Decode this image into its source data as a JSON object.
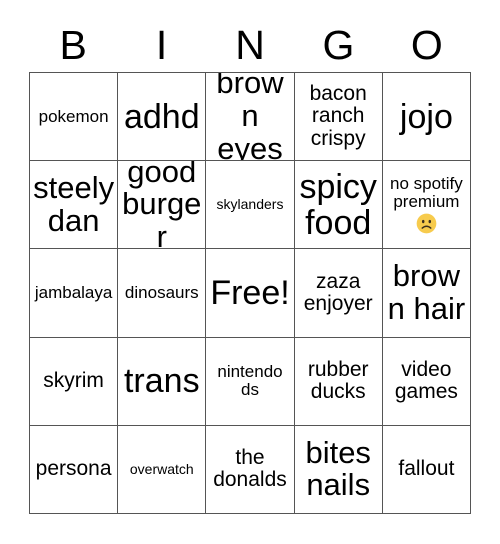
{
  "card": {
    "title": "BINGO",
    "header_letters": [
      "B",
      "I",
      "N",
      "G",
      "O"
    ],
    "rows": [
      [
        {
          "text": "pokemon",
          "size": "fs-sm"
        },
        {
          "text": "adhd",
          "size": "fs-xxl"
        },
        {
          "text": "brown eyes",
          "size": "fs-xl"
        },
        {
          "text": "bacon ranch crispy",
          "size": "fs-md"
        },
        {
          "text": "jojo",
          "size": "fs-xxl"
        }
      ],
      [
        {
          "text": "steely dan",
          "size": "fs-xl"
        },
        {
          "text": "good burger",
          "size": "fs-xl"
        },
        {
          "text": "skylanders",
          "size": "fs-xs"
        },
        {
          "text": "spicy food",
          "size": "fs-xxl"
        },
        {
          "text": "no spotify premium",
          "size": "fs-sm",
          "emoji": "frowning-face"
        }
      ],
      [
        {
          "text": "jambalaya",
          "size": "fs-sm"
        },
        {
          "text": "dinosaurs",
          "size": "fs-sm"
        },
        {
          "text": "Free!",
          "size": "fs-xxl",
          "free": true
        },
        {
          "text": "zaza enjoyer",
          "size": "fs-md"
        },
        {
          "text": "brown hair",
          "size": "fs-xl"
        }
      ],
      [
        {
          "text": "skyrim",
          "size": "fs-md"
        },
        {
          "text": "trans",
          "size": "fs-xxl"
        },
        {
          "text": "nintendo ds",
          "size": "fs-sm"
        },
        {
          "text": "rubber ducks",
          "size": "fs-md"
        },
        {
          "text": "video games",
          "size": "fs-md"
        }
      ],
      [
        {
          "text": "persona",
          "size": "fs-md"
        },
        {
          "text": "overwatch",
          "size": "fs-xs"
        },
        {
          "text": "the donalds",
          "size": "fs-md"
        },
        {
          "text": "bites nails",
          "size": "fs-xl"
        },
        {
          "text": "fallout",
          "size": "fs-md"
        }
      ]
    ],
    "colors": {
      "background": "#ffffff",
      "text": "#000000",
      "grid_line": "#555555",
      "emoji_face": "#f7cb4d",
      "emoji_feature": "#3a2e1e"
    }
  }
}
